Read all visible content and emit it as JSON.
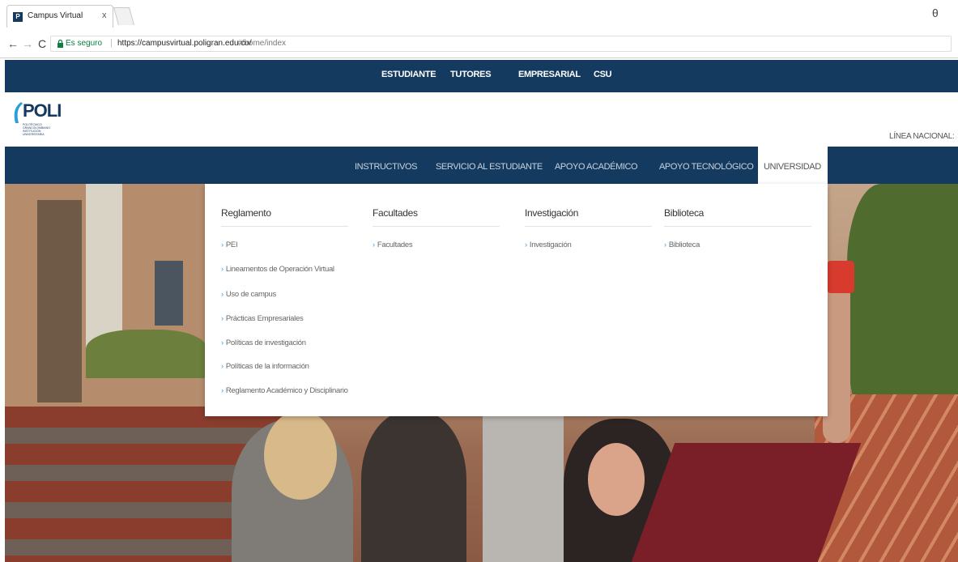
{
  "browser": {
    "tab_title": "Campus Virtual",
    "tab_close": "x",
    "favicon_text": "P",
    "secure_label": "Es seguro",
    "url_host": "https://campusvirtual.poligran.edu.co/",
    "url_path": "#/home/index",
    "back_icon": "arrow-left-icon",
    "forward_icon": "arrow-right-icon",
    "reload_icon": "reload-icon",
    "profile_glyph": "θ"
  },
  "top_nav": {
    "items": [
      "ESTUDIANTE",
      "TUTORES",
      "EMPRESARIAL",
      "CSU"
    ]
  },
  "header": {
    "logo_text": "POLI",
    "logo_sub": "POLITÉCNICO GRANCOLOMBIANO INSTITUCIÓN UNIVERSITARIA",
    "linea": "LÍNEA NACIONAL:"
  },
  "main_nav": {
    "items": [
      "INSTRUCTIVOS",
      "SERVICIO AL ESTUDIANTE",
      "APOYO ACADÉMICO",
      "APOYO TECNOLÓGICO"
    ],
    "active": "UNIVERSIDAD"
  },
  "mega_menu": {
    "columns": [
      {
        "heading": "Reglamento",
        "links": [
          "PEI",
          "Lineamentos de Operación Virtual",
          "Uso de campus",
          "Prácticas Empresariales",
          "Políticas de investigación",
          "Políticas de la información",
          "Reglamento Académico y Disciplinario"
        ]
      },
      {
        "heading": "Facultades",
        "links": [
          "Facultades"
        ]
      },
      {
        "heading": "Investigación",
        "links": [
          "Investigación"
        ]
      },
      {
        "heading": "Biblioteca",
        "links": [
          "Biblioteca"
        ]
      }
    ]
  },
  "colors": {
    "nav_blue": "#153a5f",
    "link_chevron": "#4a9bd1",
    "secure_green": "#0b8043"
  }
}
